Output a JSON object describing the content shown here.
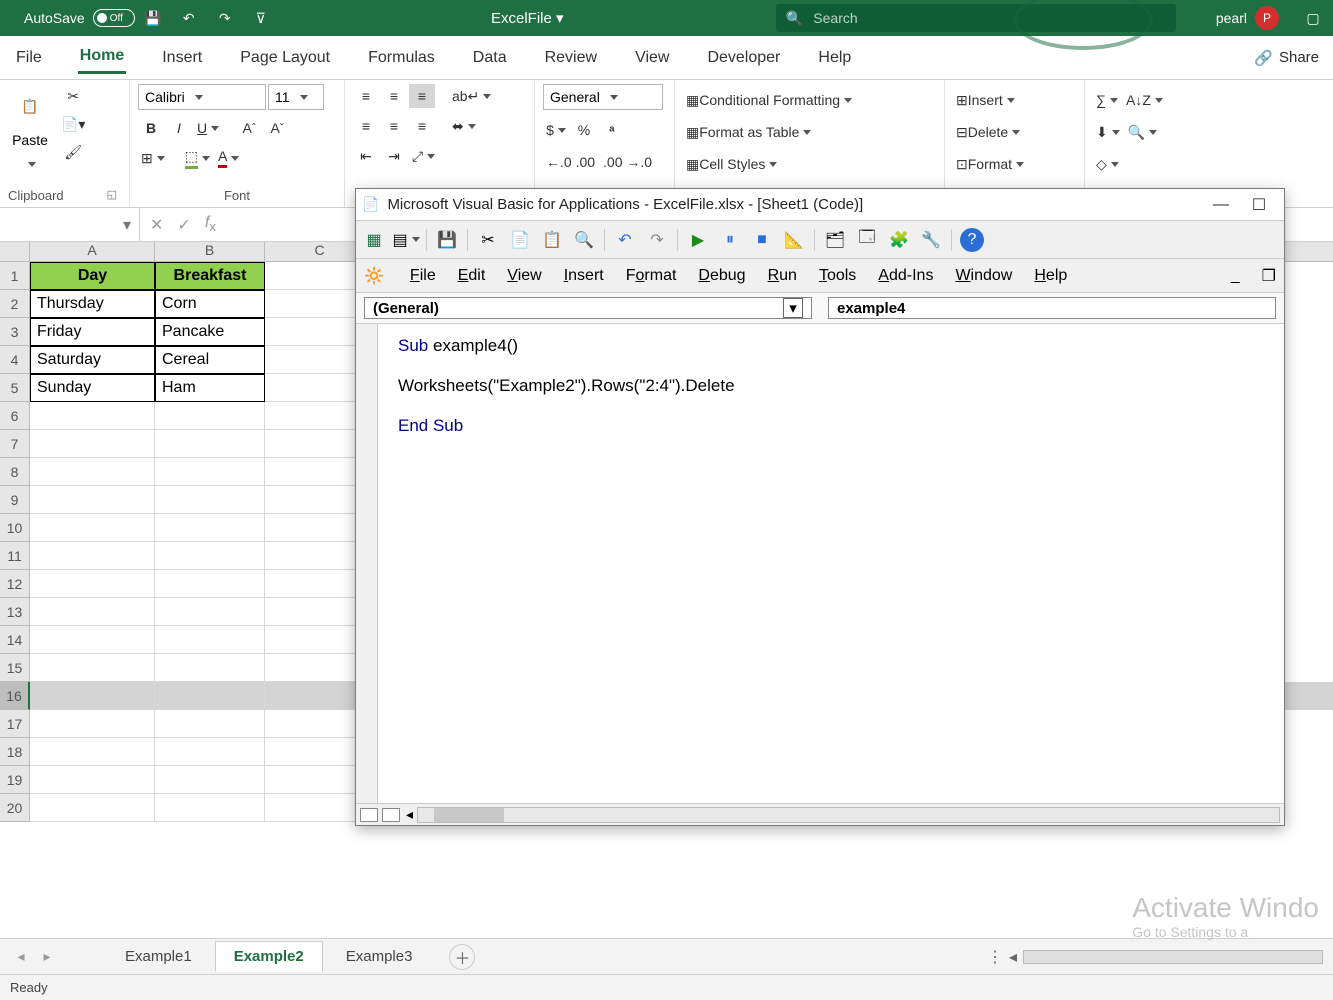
{
  "titlebar": {
    "autosave_label": "AutoSave",
    "autosave_state": "Off",
    "filename": "ExcelFile",
    "search_placeholder": "Search",
    "username": "pearl",
    "avatar_initial": "P"
  },
  "ribbon_tabs": [
    "File",
    "Home",
    "Insert",
    "Page Layout",
    "Formulas",
    "Data",
    "Review",
    "View",
    "Developer",
    "Help"
  ],
  "ribbon_active_tab": "Home",
  "share_label": "Share",
  "ribbon": {
    "clipboard": {
      "label": "Clipboard",
      "paste": "Paste"
    },
    "font": {
      "label": "Font",
      "name": "Calibri",
      "size": "11"
    },
    "number": {
      "label": "General"
    },
    "styles": {
      "cond": "Conditional Formatting",
      "table": "Format as Table",
      "cell": "Cell Styles"
    },
    "cells": {
      "insert": "Insert",
      "delete": "Delete",
      "format": "Format"
    }
  },
  "grid": {
    "columns": [
      "A",
      "B",
      "C"
    ],
    "header": [
      "Day",
      "Breakfast"
    ],
    "data": [
      [
        "Thursday",
        "Corn"
      ],
      [
        "Friday",
        "Pancake"
      ],
      [
        "Saturday",
        "Cereal"
      ],
      [
        "Sunday",
        "Ham"
      ]
    ],
    "row_labels": [
      "1",
      "2",
      "3",
      "4",
      "5",
      "6",
      "7",
      "8",
      "9",
      "10",
      "11",
      "12",
      "13",
      "14",
      "15",
      "16",
      "17",
      "18",
      "19",
      "20"
    ],
    "selected_row": "16"
  },
  "sheettabs": {
    "tabs": [
      "Example1",
      "Example2",
      "Example3"
    ],
    "active": "Example2"
  },
  "statusbar": {
    "ready": "Ready"
  },
  "watermark": {
    "line1": "Activate Windo",
    "line2": "Go to Settings to a"
  },
  "vba": {
    "title": "Microsoft Visual Basic for Applications - ExcelFile.xlsx - [Sheet1 (Code)]",
    "menus": [
      "File",
      "Edit",
      "View",
      "Insert",
      "Format",
      "Debug",
      "Run",
      "Tools",
      "Add-Ins",
      "Window",
      "Help"
    ],
    "dd_left": "(General)",
    "dd_right": "example4",
    "code_line1a": "Sub ",
    "code_line1b": "example4()",
    "code_line2": "Worksheets(\"Example2\").Rows(\"2:4\").Delete",
    "code_line3": "End Sub"
  }
}
